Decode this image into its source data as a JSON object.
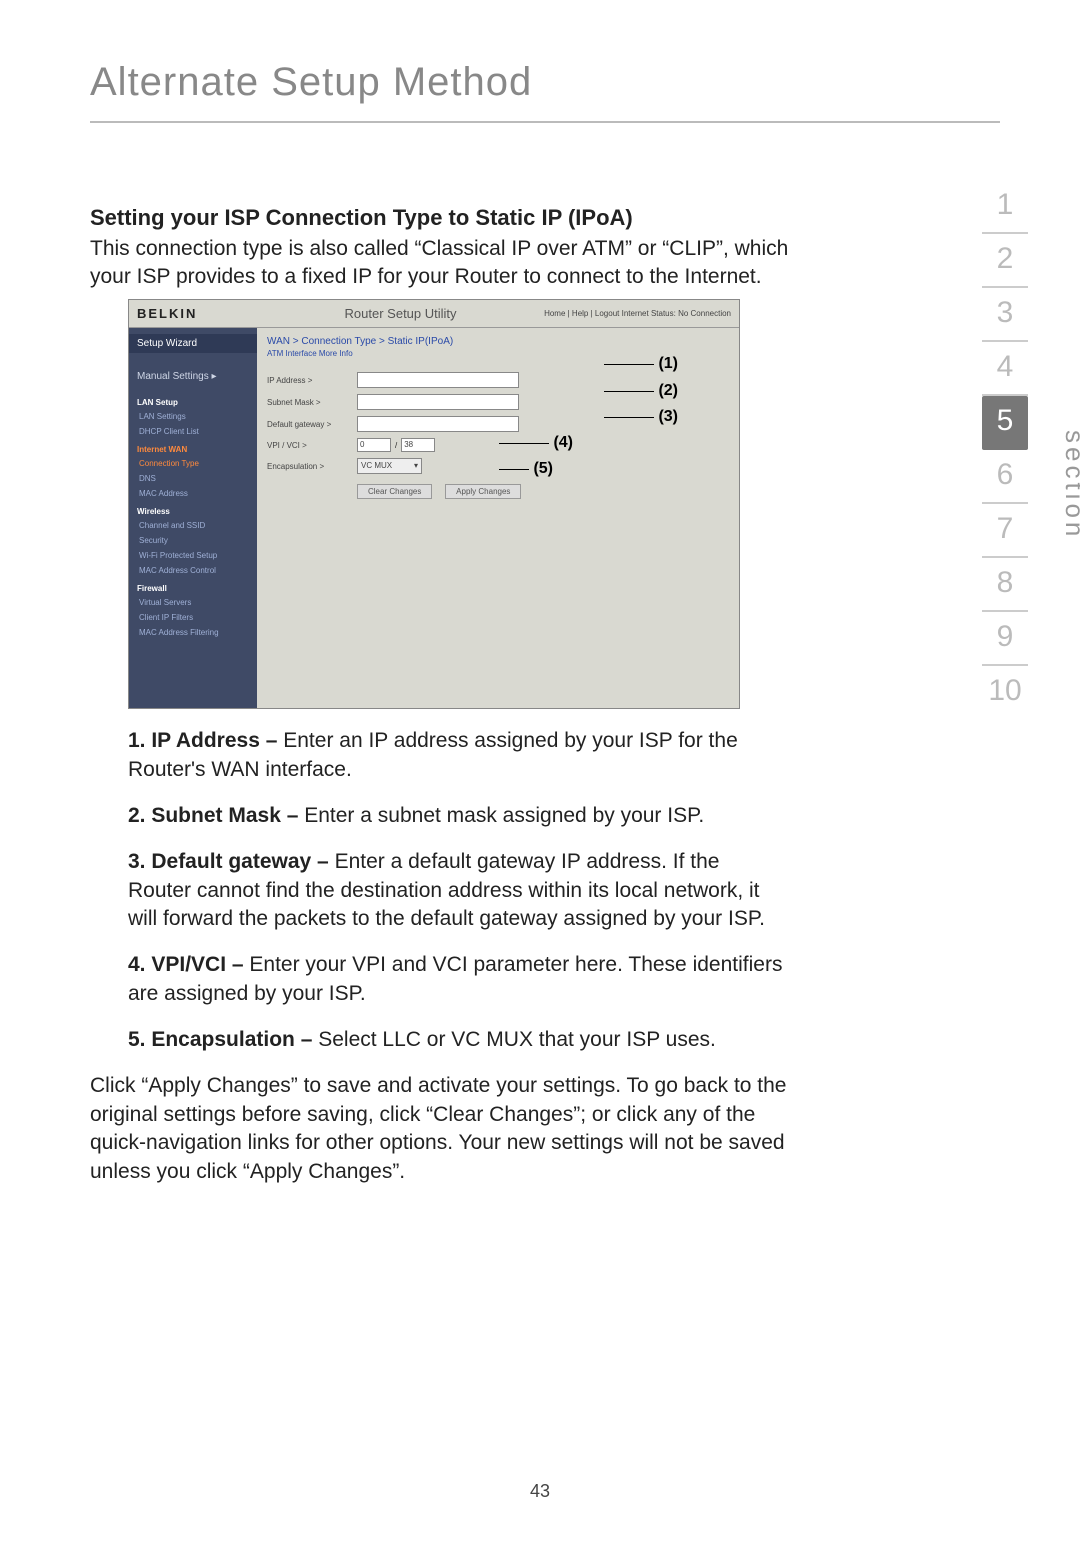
{
  "page_title": "Alternate Setup Method",
  "heading": "Setting your ISP Connection Type to Static IP (IPoA)",
  "intro": "This connection type is also called “Classical IP over ATM” or “CLIP”, which your ISP provides to a fixed IP for your Router to connect to the Internet.",
  "router_ui": {
    "logo": "BELKIN",
    "utility_title": "Router Setup Utility",
    "top_links": "Home | Help | Logout   Internet Status: No Connection",
    "sidebar": {
      "wizard": "Setup Wizard",
      "manual": "Manual Settings ▸",
      "groups": [
        {
          "cat": "LAN Setup",
          "items": [
            "LAN Settings",
            "DHCP Client List"
          ]
        },
        {
          "cat": "Internet WAN",
          "items": [
            "Connection Type",
            "DNS",
            "MAC Address"
          ]
        },
        {
          "cat": "Wireless",
          "items": [
            "Channel and SSID",
            "Security",
            "Wi-Fi Protected Setup",
            "MAC Address Control"
          ]
        },
        {
          "cat": "Firewall",
          "items": [
            "Virtual Servers",
            "Client IP Filters",
            "MAC Address Filtering"
          ]
        }
      ]
    },
    "breadcrumb": "WAN > Connection Type > Static IP(IPoA)",
    "subline": "ATM Interface   More Info",
    "fields": {
      "ip": "IP Address >",
      "mask": "Subnet Mask >",
      "gw": "Default gateway >",
      "vpi": "VPI / VCI >",
      "vpi_a": "0",
      "vpi_b": "38",
      "enc": "Encapsulation >",
      "enc_val": "VC MUX"
    },
    "buttons": {
      "clear": "Clear Changes",
      "apply": "Apply Changes"
    },
    "callouts": {
      "c1": "(1)",
      "c2": "(2)",
      "c3": "(3)",
      "c4": "(4)",
      "c5": "(5)"
    }
  },
  "list": {
    "i1b": "1. IP Address – ",
    "i1": "Enter an IP address assigned by your ISP for the Router's WAN interface.",
    "i2b": "2. Subnet Mask – ",
    "i2": "Enter a subnet mask assigned by your ISP.",
    "i3b": "3. Default gateway – ",
    "i3": "Enter a default gateway IP address. If the Router cannot find the destination address within its local network, it will forward the packets to the default gateway assigned by your ISP.",
    "i4b": "4. VPI/VCI – ",
    "i4": "Enter your VPI and VCI parameter here. These identifiers are assigned by your ISP.",
    "i5b": "5. Encapsulation – ",
    "i5": "Select LLC or VC MUX that your ISP uses."
  },
  "closing": "Click “Apply Changes” to save and activate your settings. To go back to the original settings before saving, click “Clear Changes”; or click any of the quick-navigation links for other options. Your new settings will not be saved unless you click “Apply Changes”.",
  "page_number": "43",
  "tabs": {
    "label": "section",
    "nums": [
      "1",
      "2",
      "3",
      "4",
      "5",
      "6",
      "7",
      "8",
      "9",
      "10"
    ],
    "active": "5"
  }
}
